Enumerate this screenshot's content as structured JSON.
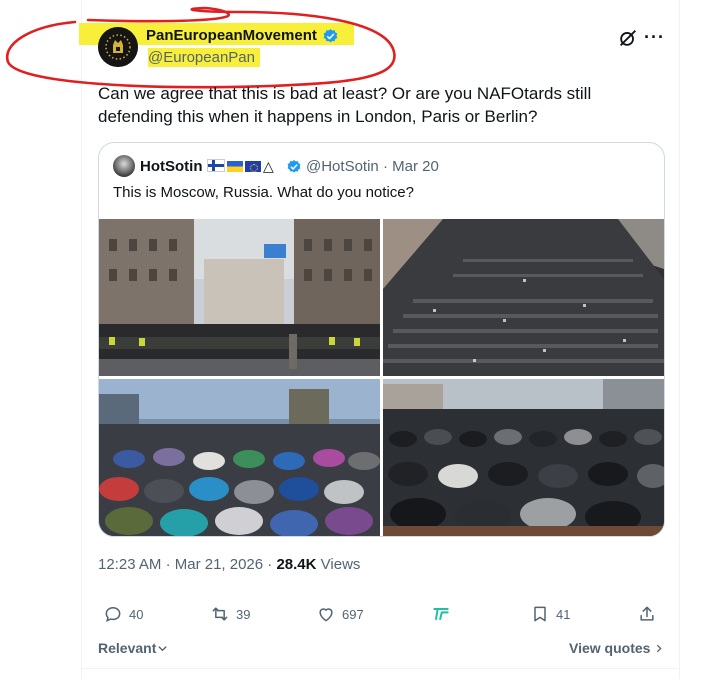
{
  "tweet": {
    "author": {
      "display_name": "PanEuropeanMovement",
      "handle": "@EuropeanPan"
    },
    "text": "Can we agree that this is bad at least? Or are you NAFOtards still defending this when it happens in London, Paris or Berlin?",
    "quote": {
      "author": {
        "display_name": "HotSotin",
        "flags": "🇫🇮🇺🇦🇪🇺△",
        "handle": "@HotSotin",
        "date": "· Mar 20"
      },
      "text": "This is Moscow, Russia. What do you notice?"
    },
    "meta": {
      "time": "12:23 AM",
      "date": "· Mar 21, 2026 ·",
      "views_count": "28.4K",
      "views_label": "Views"
    },
    "actions": {
      "replies": "40",
      "reposts": "39",
      "likes": "697",
      "bookmarks": "41"
    },
    "footer": {
      "sort_label": "Relevant",
      "view_quotes_label": "View quotes"
    }
  },
  "colors": {
    "highlight": "#f8ef3a",
    "verified": "#1d9bf0",
    "annotation": "#e02020",
    "secondary_text": "#536471",
    "grok_teal": "#1fbfa4"
  },
  "icons": [
    "grok-icon",
    "more-icon",
    "verified-icon",
    "reply-icon",
    "repost-icon",
    "like-icon",
    "grok-share-icon",
    "bookmark-icon",
    "share-icon",
    "chevron-down-icon",
    "chevron-right-icon"
  ]
}
